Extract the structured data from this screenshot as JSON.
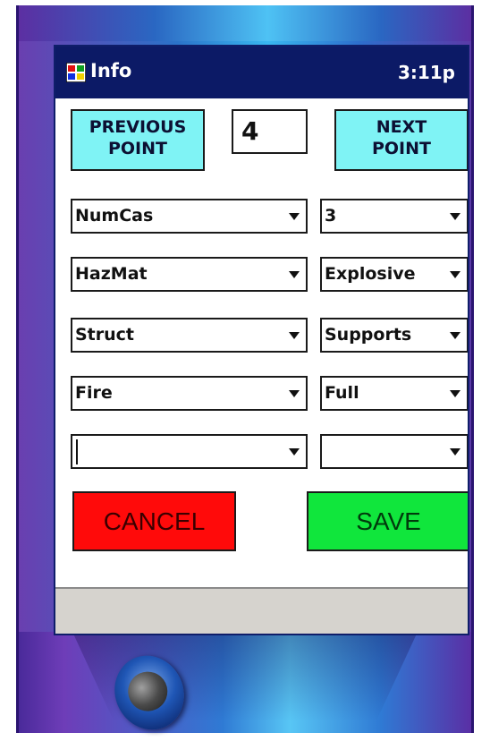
{
  "titlebar": {
    "app_name": "Info",
    "time": "3:11p"
  },
  "nav": {
    "previous_line1": "PREVIOUS",
    "previous_line2": "POINT",
    "point_number": "4",
    "next_line1": "NEXT",
    "next_line2": "POINT"
  },
  "fields": [
    {
      "name": "NumCas",
      "value": "3"
    },
    {
      "name": "HazMat",
      "value": "Explosive"
    },
    {
      "name": "Struct",
      "value": "Supports"
    },
    {
      "name": "Fire",
      "value": "Full"
    },
    {
      "name": "",
      "value": ""
    }
  ],
  "actions": {
    "cancel": "CANCEL",
    "save": "SAVE"
  },
  "colors": {
    "titlebar": "#0c1a66",
    "nav_button": "#7ff3f5",
    "cancel": "#ff0a0a",
    "save": "#10e63c",
    "menubar": "#d6d3ce"
  },
  "icons": {
    "app": "windows-flag-icon",
    "dropdown": "dropdown-arrow-icon",
    "hardware": "device-action-button"
  }
}
